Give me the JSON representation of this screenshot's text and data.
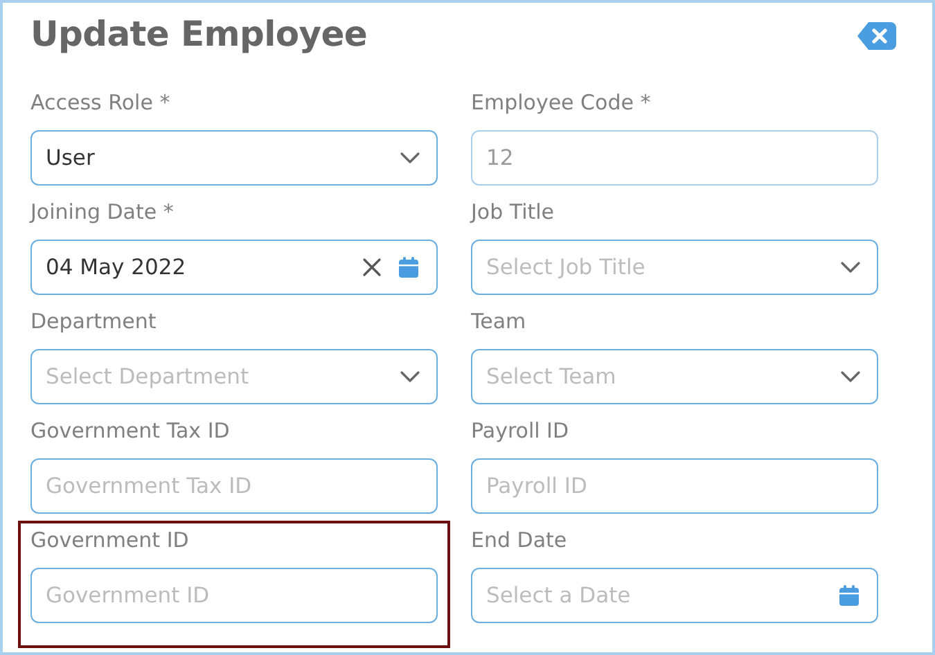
{
  "dialog": {
    "title": "Update Employee"
  },
  "fields": [
    {
      "label": "Access Role *",
      "kind": "select",
      "value": "User",
      "disabled": false,
      "highlighted": false
    },
    {
      "label": "Employee Code *",
      "kind": "text",
      "value": "12",
      "disabled": true,
      "highlighted": false
    },
    {
      "label": "Joining Date *",
      "kind": "date",
      "value": "04 May 2022",
      "disabled": false,
      "highlighted": false
    },
    {
      "label": "Job Title",
      "kind": "select",
      "placeholder": "Select Job Title",
      "disabled": false,
      "highlighted": false
    },
    {
      "label": "Department",
      "kind": "select",
      "placeholder": "Select Department",
      "disabled": false,
      "highlighted": false
    },
    {
      "label": "Team",
      "kind": "select",
      "placeholder": "Select Team",
      "disabled": false,
      "highlighted": false
    },
    {
      "label": "Government Tax ID",
      "kind": "text",
      "placeholder": "Government Tax ID",
      "disabled": false,
      "highlighted": false
    },
    {
      "label": "Payroll ID",
      "kind": "text",
      "placeholder": "Payroll ID",
      "disabled": false,
      "highlighted": false
    },
    {
      "label": "Government ID",
      "kind": "text",
      "placeholder": "Government ID",
      "disabled": false,
      "highlighted": true
    },
    {
      "label": "End Date",
      "kind": "date",
      "placeholder": "Select a Date",
      "disabled": false,
      "highlighted": false
    }
  ]
}
